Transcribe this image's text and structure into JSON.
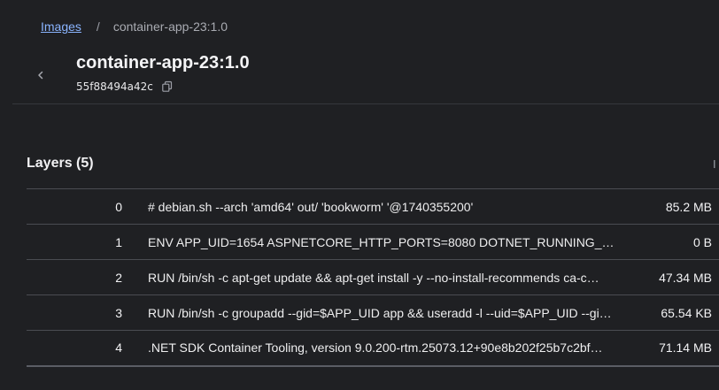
{
  "breadcrumb": {
    "root_label": "Images",
    "separator": "/",
    "current": "container-app-23:1.0"
  },
  "header": {
    "title": "container-app-23:1.0",
    "image_id": "55f88494a42c",
    "back_icon": "chevron-left-icon",
    "copy_icon": "copy-icon"
  },
  "layers": {
    "title": "Layers (5)",
    "edge_label": "I",
    "rows": [
      {
        "index": "0",
        "command": "# debian.sh --arch 'amd64' out/ 'bookworm' '@1740355200'",
        "size": "85.2 MB"
      },
      {
        "index": "1",
        "command": "ENV APP_UID=1654 ASPNETCORE_HTTP_PORTS=8080 DOTNET_RUNNING_IN_…",
        "size": "0 B"
      },
      {
        "index": "2",
        "command": "RUN /bin/sh -c apt-get update && apt-get install -y --no-install-recommends ca-c…",
        "size": "47.34 MB"
      },
      {
        "index": "3",
        "command": "RUN /bin/sh -c groupadd --gid=$APP_UID app && useradd -l --uid=$APP_UID --gi…",
        "size": "65.54 KB"
      },
      {
        "index": "4",
        "command": ".NET SDK Container Tooling, version 9.0.200-rtm.25073.12+90e8b202f25b7c2bf…",
        "size": "71.14 MB"
      }
    ]
  },
  "colors": {
    "background": "#1f2023",
    "link": "#8ab4ff",
    "text": "#e8e8ea",
    "muted": "#a9abb2",
    "divider": "#4a4c52"
  }
}
